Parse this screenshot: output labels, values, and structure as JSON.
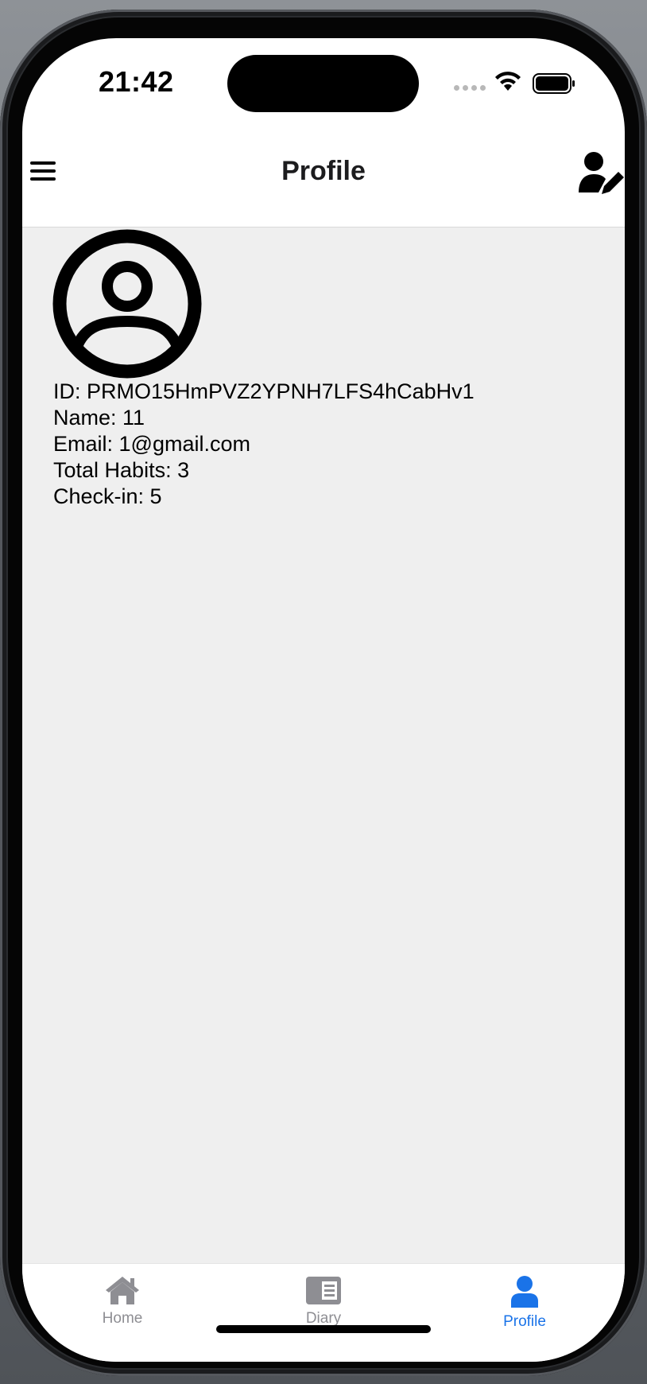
{
  "status_bar": {
    "time": "21:42"
  },
  "header": {
    "title": "Profile",
    "left_icon": "menu-icon",
    "right_icon": "edit-profile-icon"
  },
  "profile": {
    "avatar_icon": "user-circle-icon",
    "id_line": "ID: PRMO15HmPVZ2YPNH7LFS4hCabHv1",
    "name_line": "Name: 11",
    "email_line": "Email: 1@gmail.com",
    "habits_line": "Total Habits: 3",
    "checkin_line": "Check-in: 5"
  },
  "tabs": [
    {
      "label": "Home",
      "icon": "home-icon",
      "active": false
    },
    {
      "label": "Diary",
      "icon": "diary-icon",
      "active": false
    },
    {
      "label": "Profile",
      "icon": "profile-icon",
      "active": true
    }
  ],
  "colors": {
    "accent": "#1a73e8",
    "inactive": "#8e8e93",
    "content_background": "#efefef"
  }
}
